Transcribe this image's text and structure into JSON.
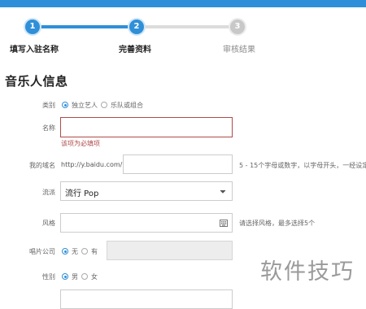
{
  "steps": [
    {
      "number": "1",
      "label": "填写入驻名称"
    },
    {
      "number": "2",
      "label": "完善资料"
    },
    {
      "number": "3",
      "label": "审核结果"
    }
  ],
  "section_title": "音乐人信息",
  "form": {
    "category": {
      "label": "类别",
      "options": [
        "独立艺人",
        "乐队或组合"
      ],
      "selected": "独立艺人"
    },
    "name": {
      "label": "名称",
      "value": "",
      "error": "该项为必填项"
    },
    "domain": {
      "label": "我的域名",
      "prefix": "http://y.baidu.com/",
      "value": "",
      "hint": "5 - 15个字母或数字，以字母开头，一经设定"
    },
    "genre": {
      "label": "流派",
      "value": "流行 Pop"
    },
    "style": {
      "label": "风格",
      "value": "",
      "hint": "请选择风格，最多选择5个"
    },
    "label_company": {
      "label": "唱片公司",
      "options": [
        "无",
        "有"
      ],
      "selected": "无"
    },
    "gender": {
      "label": "性别",
      "options": [
        "男",
        "女"
      ],
      "selected": "男"
    }
  },
  "watermark": "软件技巧",
  "colors": {
    "accent": "#2f8fd8",
    "error": "#b04a4a",
    "inactive": "#c8c8c8"
  }
}
